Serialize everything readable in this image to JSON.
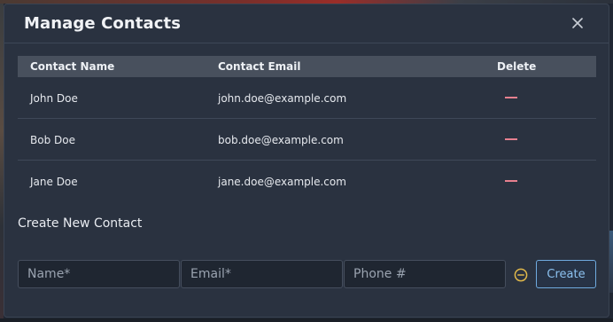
{
  "modal": {
    "title": "Manage Contacts"
  },
  "icons": {
    "close": "close-icon",
    "remove": "minus-circle-icon"
  },
  "colors": {
    "accent": "#6faadf",
    "delete": "#e6808f",
    "remove_icon": "#e0b84a"
  },
  "table": {
    "headers": {
      "name": "Contact Name",
      "email": "Contact Email",
      "delete": "Delete"
    },
    "rows": [
      {
        "name": "John Doe",
        "email": "john.doe@example.com"
      },
      {
        "name": "Bob Doe",
        "email": "bob.doe@example.com"
      },
      {
        "name": "Jane Doe",
        "email": "jane.doe@example.com"
      }
    ]
  },
  "create": {
    "title": "Create New Contact",
    "name_placeholder": "Name*",
    "email_placeholder": "Email*",
    "phone_placeholder": "Phone #",
    "button_label": "Create"
  }
}
